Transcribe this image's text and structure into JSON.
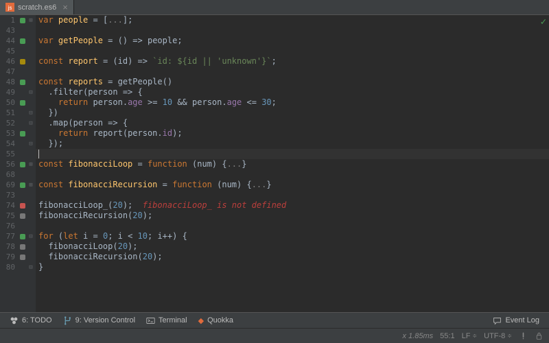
{
  "tab": {
    "filename": "scratch.es6"
  },
  "gutter": {
    "lines": [
      "1",
      "43",
      "44",
      "45",
      "46",
      "47",
      "48",
      "49",
      "50",
      "51",
      "52",
      "53",
      "54",
      "55",
      "56",
      "68",
      "69",
      "73",
      "74",
      "75",
      "76",
      "77",
      "78",
      "79",
      "80"
    ],
    "markers": [
      "green",
      "",
      "green",
      "",
      "yellow",
      "",
      "green",
      "",
      "green",
      "",
      "",
      "green",
      "",
      "",
      "green",
      "",
      "green",
      "",
      "red",
      "grey",
      "",
      "green",
      "grey",
      "grey",
      ""
    ],
    "folds": [
      "+",
      "",
      "",
      "",
      "",
      "",
      "",
      "-",
      "",
      "-",
      "-",
      "",
      "-",
      "",
      "+",
      "",
      "+",
      "",
      "",
      "",
      "",
      "-",
      "",
      "",
      "-"
    ]
  },
  "code": {
    "l0": {
      "pre": "",
      "kw": "var",
      "sp": " ",
      "def": "people",
      "rest": " = [",
      "fold": "...",
      "end": "];"
    },
    "l1": {
      "text": ""
    },
    "l2": {
      "pre": "",
      "kw": "var",
      "sp": " ",
      "def": "getPeople",
      "mid": " = () => ",
      "id": "people",
      "end": ";"
    },
    "l3": {
      "text": ""
    },
    "l4": {
      "pre": "",
      "kw": "const",
      "sp": " ",
      "def": "report",
      "mid": " = (id) => ",
      "str": "`id: ${id || 'unknown'}`",
      "end": ";"
    },
    "l5": {
      "text": ""
    },
    "l6": {
      "pre": "",
      "kw": "const",
      "sp": " ",
      "def": "reports",
      "mid": " = getPeople()"
    },
    "l7": {
      "pre": "  .filter(person => {"
    },
    "l8": {
      "pre": "    ",
      "kw": "return",
      "mid": " person.",
      "p1": "age",
      "cmp": " >= ",
      "n1": "10",
      "and": " && ",
      "mid2": "person.",
      "p2": "age",
      "cmp2": " <= ",
      "n2": "30",
      "end": ";"
    },
    "l9": {
      "pre": "  })"
    },
    "l10": {
      "pre": "  .map(person => {"
    },
    "l11": {
      "pre": "    ",
      "kw": "return",
      "mid": " report(person.",
      "p1": "id",
      "end": ");"
    },
    "l12": {
      "pre": "  });"
    },
    "l13": {
      "text": ""
    },
    "l14": {
      "pre": "",
      "kw": "const",
      "sp": " ",
      "def": "fibonacciLoop",
      "mid": " = ",
      "kw2": "function",
      "args": " (num) {",
      "fold": "...",
      "end": "}"
    },
    "l15": {
      "text": ""
    },
    "l16": {
      "pre": "",
      "kw": "const",
      "sp": " ",
      "def": "fibonacciRecursion",
      "mid": " = ",
      "kw2": "function",
      "args": " (num) {",
      "fold": "...",
      "end": "}"
    },
    "l17": {
      "text": ""
    },
    "l18": {
      "pre": "fibonacciLoop_(",
      "n": "20",
      "mid": ");  ",
      "err": "fibonacciLoop_ is not defined"
    },
    "l19": {
      "pre": "fibonacciRecursion(",
      "n": "20",
      "end": ");"
    },
    "l20": {
      "text": ""
    },
    "l21": {
      "kw": "for",
      "pre": " (",
      "kw2": "let",
      "mid": " i = ",
      "n1": "0",
      "mid2": "; i < ",
      "n2": "10",
      "mid3": "; i++) {"
    },
    "l22": {
      "pre": "  fibonacciLoop(",
      "n": "20",
      "end": ");"
    },
    "l23": {
      "pre": "  fibonacciRecursion(",
      "n": "20",
      "end": ");"
    },
    "l24": {
      "pre": "}"
    }
  },
  "toolwin": {
    "todo": "6: TODO",
    "vcs": "9: Version Control",
    "terminal": "Terminal",
    "quokka": "Quokka",
    "eventlog": "Event Log"
  },
  "status": {
    "timing": "x 1.85ms",
    "pos": "55:1",
    "lf": "LF",
    "enc": "UTF-8"
  },
  "current_line_index": 13
}
